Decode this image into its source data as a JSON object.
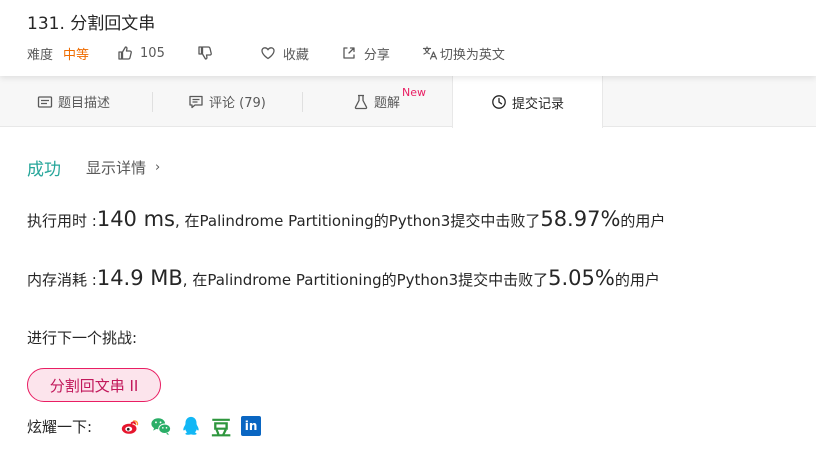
{
  "problem": {
    "title": "131. 分割回文串",
    "difficulty_label": "难度",
    "difficulty": "中等",
    "likes": "105",
    "collect_label": "收藏",
    "share_label": "分享",
    "translate_label": "切换为英文"
  },
  "tabs": [
    {
      "label": "题目描述",
      "icon": "document-icon"
    },
    {
      "label": "评论 (79)",
      "icon": "comment-icon"
    },
    {
      "label": "题解",
      "badge": "New",
      "icon": "flask-icon"
    },
    {
      "label": "提交记录",
      "icon": "clock-icon",
      "active": true
    }
  ],
  "result": {
    "status": "成功",
    "details_label": "显示详情",
    "details_chevron": "›",
    "runtime": {
      "label": "执行用时 : ",
      "value": "140 ms",
      "middle": ", 在Palindrome Partitioning的Python3提交中击败了",
      "percent": "58.97%",
      "suffix": " 的用户"
    },
    "memory": {
      "label": "内存消耗 : ",
      "value": "14.9 MB",
      "middle": ", 在Palindrome Partitioning的Python3提交中击败了",
      "percent": "5.05%",
      "suffix": " 的用户"
    }
  },
  "next": {
    "label": "进行下一个挑战:",
    "button": "分割回文串 II"
  },
  "share": {
    "label": "炫耀一下:",
    "douban_glyph": "豆",
    "linkedin_glyph": "in",
    "icons": [
      "weibo-icon",
      "wechat-icon",
      "qq-icon",
      "douban-icon",
      "linkedin-icon"
    ]
  },
  "colors": {
    "success": "#26a69a",
    "difficulty": "#ef6c00",
    "accent_pink": "#e91e63"
  }
}
